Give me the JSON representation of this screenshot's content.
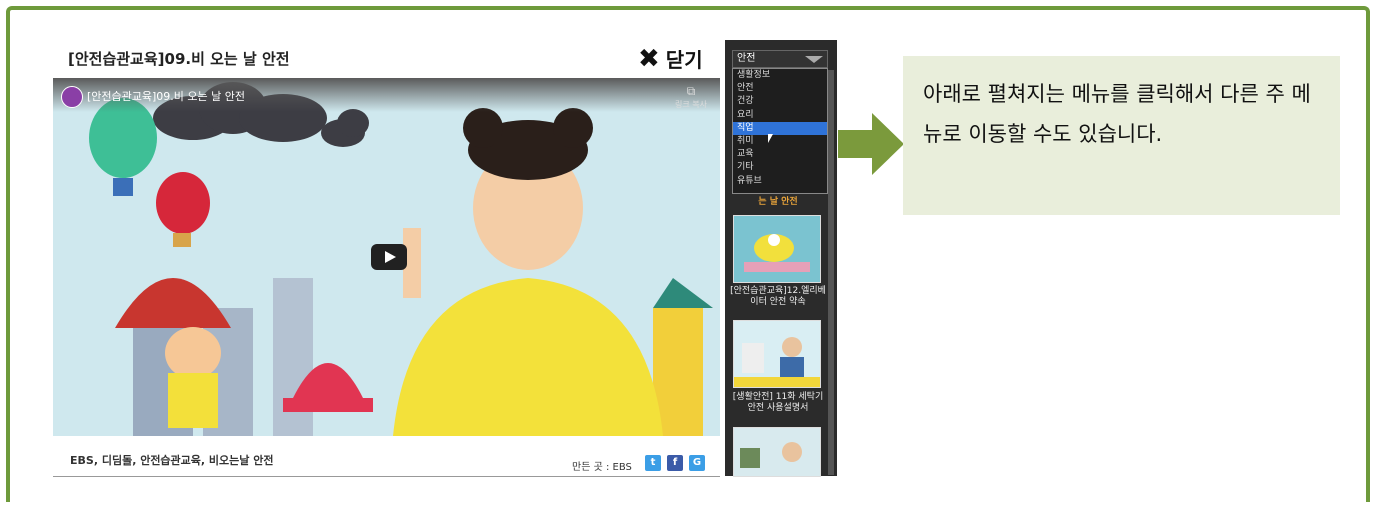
{
  "video": {
    "title": "[안전습관교육]09.비 오는 날 안전",
    "close_label": "닫기",
    "player_title": "[안전습관교육]09.비 오는 날 안전",
    "copy_link_label": "링크 복사",
    "tags": "EBS, 디딤돌, 안전습관교육, 비오는날 안전",
    "maker": "만든 곳 : EBS",
    "share": [
      {
        "icon": "twitter-icon",
        "label": "t",
        "color": "#3b9ee6"
      },
      {
        "icon": "facebook-icon",
        "label": "f",
        "color": "#3b5ba8"
      },
      {
        "icon": "google-icon",
        "label": "G",
        "color": "#3b9ee6"
      }
    ]
  },
  "sidebar": {
    "category_selected": "안전",
    "menu_items": [
      "생활정보",
      "안전",
      "건강",
      "요리",
      "직업",
      "취미",
      "교육",
      "기타",
      "유튜브"
    ],
    "selected_index": 4,
    "partial_caption": "는 날 안전",
    "videos": [
      {
        "caption": "[안전습관교육]12.엘리베이터 안전 약속"
      },
      {
        "caption": "[생활안전] 11화 세탁기 안전 사용설명서"
      }
    ]
  },
  "callout": {
    "text": "아래로 펼쳐지는 메뉴를 클릭해서 다른 주 메뉴로 이동할 수도 있습니다."
  },
  "colors": {
    "frame": "#6e9a3b",
    "arrow": "#7b9a3c",
    "callout_bg": "#e9eedb",
    "menu_highlight": "#2f73d8"
  }
}
